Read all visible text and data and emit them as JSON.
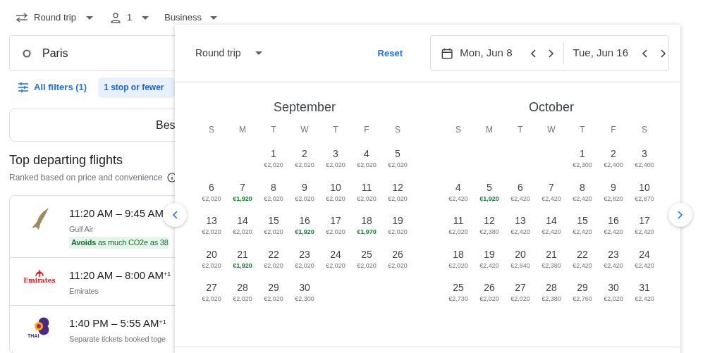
{
  "top_bar": {
    "trip_type": "Round trip",
    "passengers": "1",
    "cabin": "Business"
  },
  "origin": {
    "value": "Paris"
  },
  "filters": {
    "all_filters": "All filters (1)",
    "chip": {
      "label": "1 stop or fewer",
      "selected": true
    }
  },
  "sort": {
    "label": "Bes"
  },
  "section": {
    "title": "Top departing flights",
    "subtitle": "Ranked based on price and convenience"
  },
  "flights": [
    {
      "kind": "falcon",
      "times": "11:20 AM – 9:45 AM",
      "airline": "Gulf Air",
      "eco_bold": "Avoids",
      "eco_rest": " as much CO2e as 38"
    },
    {
      "kind": "emirates",
      "logo_text": "Emirates",
      "times": "11:20 AM – 8:00 AM",
      "plus_day": "+1",
      "airline": "Emirates"
    },
    {
      "kind": "thai",
      "logo_text": "THAI",
      "times": "1:40 PM – 5:55 AM",
      "plus_day": "+1",
      "airline": "Separate tickets booked toge"
    }
  ],
  "picker": {
    "trip_type": "Round trip",
    "reset": "Reset",
    "depart": "Mon, Jun 8",
    "return": "Tue, Jun 16",
    "months": [
      {
        "name": "September",
        "weekdays": [
          "S",
          "M",
          "T",
          "W",
          "T",
          "F",
          "S"
        ],
        "weeks": [
          [
            {
              "kind": "blank"
            },
            {
              "kind": "blank"
            },
            {
              "kind": "day",
              "day": "1",
              "price": "€2,020",
              "low": false
            },
            {
              "kind": "day",
              "day": "2",
              "price": "€2,020",
              "low": false
            },
            {
              "kind": "day",
              "day": "3",
              "price": "€2,020",
              "low": false
            },
            {
              "kind": "day",
              "day": "4",
              "price": "€2,020",
              "low": false
            },
            {
              "kind": "day",
              "day": "5",
              "price": "€2,020",
              "low": false
            }
          ],
          [
            {
              "kind": "day",
              "day": "6",
              "price": "€2,020",
              "low": false
            },
            {
              "kind": "day",
              "day": "7",
              "price": "€1,920",
              "low": true
            },
            {
              "kind": "day",
              "day": "8",
              "price": "€2,020",
              "low": false
            },
            {
              "kind": "day",
              "day": "9",
              "price": "€2,020",
              "low": false
            },
            {
              "kind": "day",
              "day": "10",
              "price": "€2,020",
              "low": false
            },
            {
              "kind": "day",
              "day": "11",
              "price": "€2,020",
              "low": false
            },
            {
              "kind": "day",
              "day": "12",
              "price": "€2,020",
              "low": false
            }
          ],
          [
            {
              "kind": "day",
              "day": "13",
              "price": "€2,020",
              "low": false
            },
            {
              "kind": "day",
              "day": "14",
              "price": "€2,020",
              "low": false
            },
            {
              "kind": "day",
              "day": "15",
              "price": "€2,020",
              "low": false
            },
            {
              "kind": "day",
              "day": "16",
              "price": "€1,920",
              "low": true
            },
            {
              "kind": "day",
              "day": "17",
              "price": "€2,020",
              "low": false
            },
            {
              "kind": "day",
              "day": "18",
              "price": "€1,970",
              "low": true
            },
            {
              "kind": "day",
              "day": "19",
              "price": "€2,020",
              "low": false
            }
          ],
          [
            {
              "kind": "day",
              "day": "20",
              "price": "€2,020",
              "low": false
            },
            {
              "kind": "day",
              "day": "21",
              "price": "€1,920",
              "low": true
            },
            {
              "kind": "day",
              "day": "22",
              "price": "€2,020",
              "low": false
            },
            {
              "kind": "day",
              "day": "23",
              "price": "€2,020",
              "low": false
            },
            {
              "kind": "day",
              "day": "24",
              "price": "€2,020",
              "low": false
            },
            {
              "kind": "day",
              "day": "25",
              "price": "€2,020",
              "low": false
            },
            {
              "kind": "day",
              "day": "26",
              "price": "€2,020",
              "low": false
            }
          ],
          [
            {
              "kind": "day",
              "day": "27",
              "price": "€2,020",
              "low": false
            },
            {
              "kind": "day",
              "day": "28",
              "price": "€2,020",
              "low": false
            },
            {
              "kind": "day",
              "day": "29",
              "price": "€2,020",
              "low": false
            },
            {
              "kind": "day",
              "day": "30",
              "price": "€2,300",
              "low": false
            }
          ]
        ]
      },
      {
        "name": "October",
        "weekdays": [
          "S",
          "M",
          "T",
          "W",
          "T",
          "F",
          "S"
        ],
        "weeks": [
          [
            {
              "kind": "blank"
            },
            {
              "kind": "blank"
            },
            {
              "kind": "blank"
            },
            {
              "kind": "blank"
            },
            {
              "kind": "day",
              "day": "1",
              "price": "€2,300",
              "low": false
            },
            {
              "kind": "day",
              "day": "2",
              "price": "€2,400",
              "low": false
            },
            {
              "kind": "day",
              "day": "3",
              "price": "€2,400",
              "low": false
            }
          ],
          [
            {
              "kind": "day",
              "day": "4",
              "price": "€2,420",
              "low": false
            },
            {
              "kind": "day",
              "day": "5",
              "price": "€1,920",
              "low": true
            },
            {
              "kind": "day",
              "day": "6",
              "price": "€2,420",
              "low": false
            },
            {
              "kind": "day",
              "day": "7",
              "price": "€2,420",
              "low": false
            },
            {
              "kind": "day",
              "day": "8",
              "price": "€2,420",
              "low": false
            },
            {
              "kind": "day",
              "day": "9",
              "price": "€2,820",
              "low": false
            },
            {
              "kind": "day",
              "day": "10",
              "price": "€2,870",
              "low": false
            }
          ],
          [
            {
              "kind": "day",
              "day": "11",
              "price": "€2,020",
              "low": false
            },
            {
              "kind": "day",
              "day": "12",
              "price": "€2,380",
              "low": false
            },
            {
              "kind": "day",
              "day": "13",
              "price": "€2,420",
              "low": false
            },
            {
              "kind": "day",
              "day": "14",
              "price": "€2,420",
              "low": false
            },
            {
              "kind": "day",
              "day": "15",
              "price": "€2,420",
              "low": false
            },
            {
              "kind": "day",
              "day": "16",
              "price": "€2,420",
              "low": false
            },
            {
              "kind": "day",
              "day": "17",
              "price": "€2,420",
              "low": false
            }
          ],
          [
            {
              "kind": "day",
              "day": "18",
              "price": "€2,020",
              "low": false
            },
            {
              "kind": "day",
              "day": "19",
              "price": "€2,420",
              "low": false
            },
            {
              "kind": "day",
              "day": "20",
              "price": "€2,840",
              "low": false
            },
            {
              "kind": "day",
              "day": "21",
              "price": "€2,380",
              "low": false
            },
            {
              "kind": "day",
              "day": "22",
              "price": "€2,420",
              "low": false
            },
            {
              "kind": "day",
              "day": "23",
              "price": "€2,420",
              "low": false
            },
            {
              "kind": "day",
              "day": "24",
              "price": "€2,420",
              "low": false
            }
          ],
          [
            {
              "kind": "day",
              "day": "25",
              "price": "€2,730",
              "low": false
            },
            {
              "kind": "day",
              "day": "26",
              "price": "€2,020",
              "low": false
            },
            {
              "kind": "day",
              "day": "27",
              "price": "€2,020",
              "low": false
            },
            {
              "kind": "day",
              "day": "28",
              "price": "€2,380",
              "low": false
            },
            {
              "kind": "day",
              "day": "29",
              "price": "€2,760",
              "low": false
            },
            {
              "kind": "day",
              "day": "30",
              "price": "€2,020",
              "low": false
            },
            {
              "kind": "day",
              "day": "31",
              "price": "€2,420",
              "low": false
            }
          ]
        ]
      }
    ]
  }
}
